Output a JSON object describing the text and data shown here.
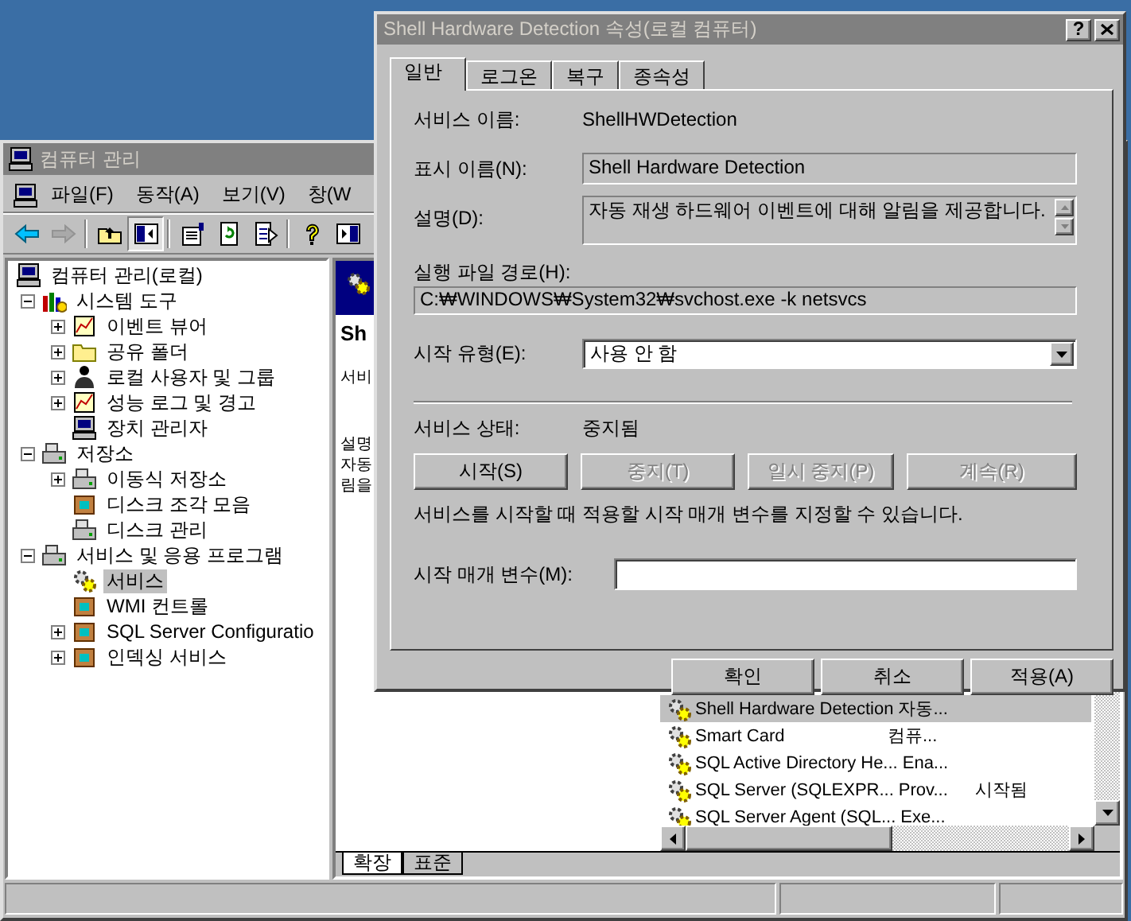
{
  "main_window": {
    "title": "컴퓨터 관리",
    "menu": [
      "파일(F)",
      "동작(A)",
      "보기(V)",
      "창(W"
    ],
    "toolbar": [
      {
        "kind": "back",
        "disabled": false,
        "pressed": false
      },
      {
        "kind": "forward",
        "disabled": true,
        "pressed": false
      },
      {
        "kind": "separator"
      },
      {
        "kind": "up",
        "disabled": false,
        "pressed": false
      },
      {
        "kind": "tree",
        "disabled": false,
        "pressed": true
      },
      {
        "kind": "separator"
      },
      {
        "kind": "properties",
        "disabled": false,
        "pressed": false
      },
      {
        "kind": "refresh",
        "disabled": false,
        "pressed": false
      },
      {
        "kind": "export",
        "disabled": false,
        "pressed": false
      },
      {
        "kind": "separator"
      },
      {
        "kind": "help",
        "disabled": false,
        "pressed": false
      },
      {
        "kind": "panel",
        "disabled": false,
        "pressed": false
      }
    ],
    "tree": [
      {
        "label": "컴퓨터 관리(로컬)",
        "kind": "computer",
        "selected": false,
        "children": [
          {
            "label": "시스템 도구",
            "kind": "tools",
            "selected": false,
            "expanded": true,
            "children": [
              {
                "label": "이벤트 뷰어",
                "kind": "chart",
                "selected": false,
                "expanded": false
              },
              {
                "label": "공유 폴더",
                "kind": "folder",
                "selected": false,
                "expanded": false
              },
              {
                "label": "로컬 사용자 및 그룹",
                "kind": "users",
                "selected": false,
                "expanded": false
              },
              {
                "label": "성능 로그 및 경고",
                "kind": "chart",
                "selected": false,
                "expanded": false
              },
              {
                "label": "장치 관리자",
                "kind": "computer",
                "selected": false
              }
            ]
          },
          {
            "label": "저장소",
            "kind": "drive",
            "selected": false,
            "expanded": true,
            "children": [
              {
                "label": "이동식 저장소",
                "kind": "drive",
                "selected": false,
                "expanded": false
              },
              {
                "label": "디스크 조각 모음",
                "kind": "box",
                "selected": false
              },
              {
                "label": "디스크 관리",
                "kind": "drive",
                "selected": false
              }
            ]
          },
          {
            "label": "서비스 및 응용 프로그램",
            "kind": "drive",
            "selected": false,
            "expanded": true,
            "children": [
              {
                "label": "서비스",
                "kind": "gear",
                "selected": true
              },
              {
                "label": "WMI 컨트롤",
                "kind": "box",
                "selected": false
              },
              {
                "label": "SQL Server Configuratio",
                "kind": "box",
                "selected": false,
                "expanded": false
              },
              {
                "label": "인덱싱 서비스",
                "kind": "box",
                "selected": false,
                "expanded": false
              }
            ]
          }
        ]
      }
    ],
    "detail": {
      "heading": "Sh",
      "texts": [
        "서비",
        "설명",
        "자동",
        "림을"
      ]
    },
    "services": [
      {
        "name": "Shell Hardware Detection",
        "column_2": "자동...",
        "selected": true
      },
      {
        "name": "Smart Card",
        "column_2": "컴퓨...",
        "selected": false
      },
      {
        "name": "SQL Active Directory He...",
        "column_2": "Ena...",
        "selected": false
      },
      {
        "name": "SQL Server (SQLEXPR...",
        "column_2": "Prov...",
        "column_3": "시작됨",
        "selected": false
      },
      {
        "name": "SQL Server Agent (SQL...",
        "column_2": "Exe...",
        "selected": false
      }
    ],
    "view_tabs": [
      {
        "label": "확장",
        "selected": true
      },
      {
        "label": "표준",
        "selected": false
      }
    ]
  },
  "dialog": {
    "title": "Shell Hardware Detection 속성(로컬 컴퓨터)",
    "help_button": "?",
    "tabs": [
      {
        "label": "일반",
        "selected": true
      },
      {
        "label": "로그온",
        "selected": false
      },
      {
        "label": "복구",
        "selected": false
      },
      {
        "label": "종속성",
        "selected": false
      }
    ],
    "service_name_label": "서비스 이름:",
    "service_name": "ShellHWDetection",
    "display_name_label": "표시 이름(N):",
    "display_name": "Shell Hardware Detection",
    "description_label": "설명(D):",
    "description": "자동 재생 하드웨어 이벤트에 대해 알림을 제공합니다.",
    "path_label": "실행 파일 경로(H):",
    "path": "C:₩WINDOWS₩System32₩svchost.exe -k netsvcs",
    "startup_type_label": "시작 유형(E):",
    "startup_type": "사용 안 함",
    "status_label": "서비스 상태:",
    "status": "중지됨",
    "control_buttons": [
      {
        "label": "시작(S)",
        "disabled": false
      },
      {
        "label": "중지(T)",
        "disabled": true
      },
      {
        "label": "일시 중지(P)",
        "disabled": true
      },
      {
        "label": "계속(R)",
        "disabled": true
      }
    ],
    "note": "서비스를 시작할 때 적용할 시작 매개 변수를 지정할 수 있습니다.",
    "parameters_label": "시작 매개 변수(M):",
    "buttons": [
      "확인",
      "취소",
      "적용(A)"
    ]
  }
}
